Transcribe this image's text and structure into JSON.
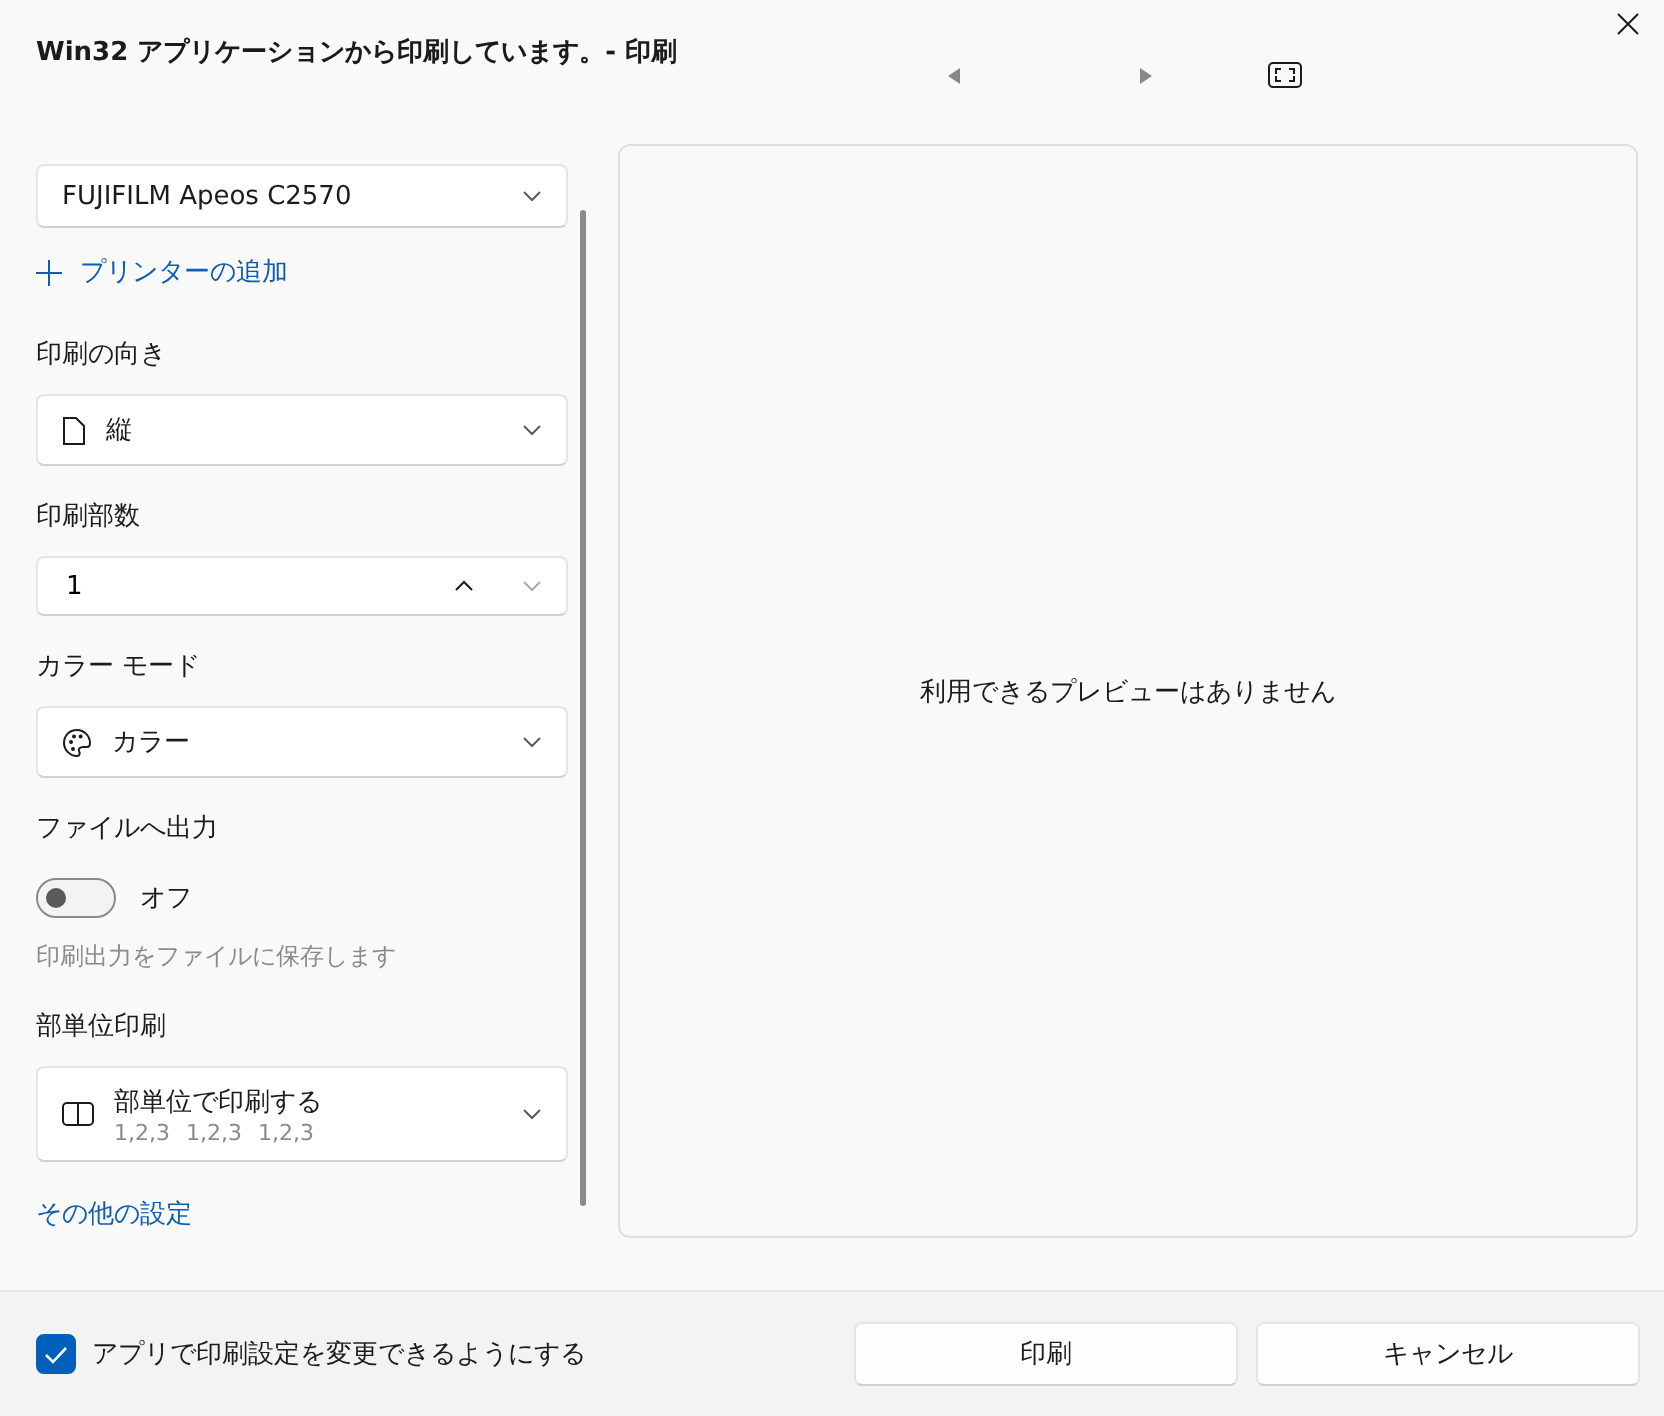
{
  "window": {
    "title": "Win32 アプリケーションから印刷しています。- 印刷"
  },
  "printer": {
    "value": "FUJIFILM Apeos C2570"
  },
  "add_printer": {
    "label": "プリンターの追加"
  },
  "settings": [
    {
      "kind": "dropdown",
      "label": "印刷の向き",
      "value": "縦"
    },
    {
      "kind": "spinner",
      "label": "印刷部数",
      "value": "1"
    },
    {
      "kind": "dropdown",
      "label": "カラー モード",
      "value": "カラー"
    },
    {
      "kind": "toggle",
      "label": "ファイルへ出力",
      "on": false,
      "state_text": "オフ",
      "description": "印刷出力をファイルに保存します"
    },
    {
      "kind": "collate",
      "label": "部単位印刷",
      "value": "部単位で印刷する",
      "detail": [
        "1,2,3",
        "1,2,3",
        "1,2,3"
      ]
    }
  ],
  "more_settings": "その他の設定",
  "preview": {
    "message": "利用できるプレビューはありません"
  },
  "footer": {
    "checkbox": {
      "label": "アプリで印刷設定を変更できるようにする",
      "checked": true
    },
    "buttons": [
      "印刷",
      "キャンセル"
    ]
  }
}
